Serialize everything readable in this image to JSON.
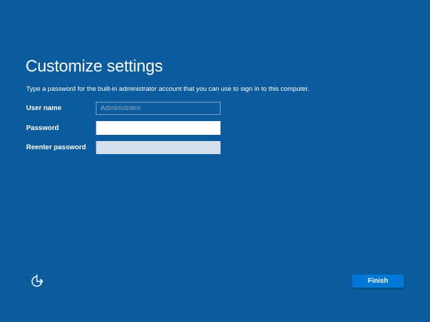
{
  "screen": {
    "title": "Customize settings",
    "subtitle": "Type a password for the built-in administrator account that you can use to sign in to this computer.",
    "form": {
      "fields": [
        {
          "id": "username",
          "label": "User name",
          "placeholder": "Administrator",
          "value": ""
        },
        {
          "id": "password",
          "label": "Password",
          "placeholder": "",
          "value": ""
        },
        {
          "id": "reenter",
          "label": "Reenter password",
          "placeholder": "",
          "value": ""
        }
      ]
    },
    "footer": {
      "finish_label": "Finish",
      "ease_of_access_icon": "ease-of-access-icon"
    },
    "colors": {
      "background": "#0b5c9e",
      "button": "#0078d7",
      "input_border": "#7aa6cd",
      "placeholder": "#8fa6ba",
      "reenter_fill": "#d3e0eb",
      "text": "#ffffff"
    }
  }
}
